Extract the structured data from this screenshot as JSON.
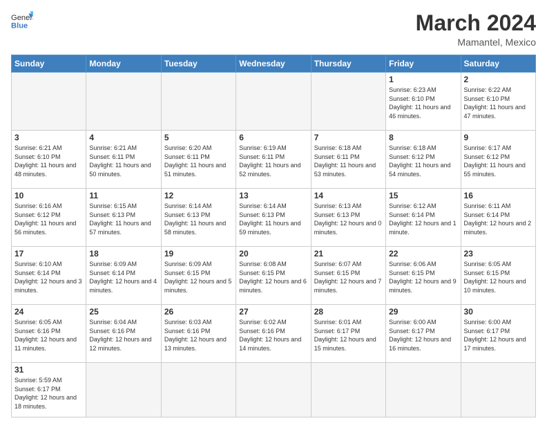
{
  "header": {
    "logo_general": "General",
    "logo_blue": "Blue",
    "month_year": "March 2024",
    "location": "Mamantel, Mexico"
  },
  "weekdays": [
    "Sunday",
    "Monday",
    "Tuesday",
    "Wednesday",
    "Thursday",
    "Friday",
    "Saturday"
  ],
  "weeks": [
    [
      {
        "day": "",
        "empty": true
      },
      {
        "day": "",
        "empty": true
      },
      {
        "day": "",
        "empty": true
      },
      {
        "day": "",
        "empty": true
      },
      {
        "day": "",
        "empty": true
      },
      {
        "day": "1",
        "sunrise": "6:23 AM",
        "sunset": "6:10 PM",
        "daylight": "11 hours and 46 minutes."
      },
      {
        "day": "2",
        "sunrise": "6:22 AM",
        "sunset": "6:10 PM",
        "daylight": "11 hours and 47 minutes."
      }
    ],
    [
      {
        "day": "3",
        "sunrise": "6:21 AM",
        "sunset": "6:10 PM",
        "daylight": "11 hours and 48 minutes."
      },
      {
        "day": "4",
        "sunrise": "6:21 AM",
        "sunset": "6:11 PM",
        "daylight": "11 hours and 50 minutes."
      },
      {
        "day": "5",
        "sunrise": "6:20 AM",
        "sunset": "6:11 PM",
        "daylight": "11 hours and 51 minutes."
      },
      {
        "day": "6",
        "sunrise": "6:19 AM",
        "sunset": "6:11 PM",
        "daylight": "11 hours and 52 minutes."
      },
      {
        "day": "7",
        "sunrise": "6:18 AM",
        "sunset": "6:11 PM",
        "daylight": "11 hours and 53 minutes."
      },
      {
        "day": "8",
        "sunrise": "6:18 AM",
        "sunset": "6:12 PM",
        "daylight": "11 hours and 54 minutes."
      },
      {
        "day": "9",
        "sunrise": "6:17 AM",
        "sunset": "6:12 PM",
        "daylight": "11 hours and 55 minutes."
      }
    ],
    [
      {
        "day": "10",
        "sunrise": "6:16 AM",
        "sunset": "6:12 PM",
        "daylight": "11 hours and 56 minutes."
      },
      {
        "day": "11",
        "sunrise": "6:15 AM",
        "sunset": "6:13 PM",
        "daylight": "11 hours and 57 minutes."
      },
      {
        "day": "12",
        "sunrise": "6:14 AM",
        "sunset": "6:13 PM",
        "daylight": "11 hours and 58 minutes."
      },
      {
        "day": "13",
        "sunrise": "6:14 AM",
        "sunset": "6:13 PM",
        "daylight": "11 hours and 59 minutes."
      },
      {
        "day": "14",
        "sunrise": "6:13 AM",
        "sunset": "6:13 PM",
        "daylight": "12 hours and 0 minutes."
      },
      {
        "day": "15",
        "sunrise": "6:12 AM",
        "sunset": "6:14 PM",
        "daylight": "12 hours and 1 minute."
      },
      {
        "day": "16",
        "sunrise": "6:11 AM",
        "sunset": "6:14 PM",
        "daylight": "12 hours and 2 minutes."
      }
    ],
    [
      {
        "day": "17",
        "sunrise": "6:10 AM",
        "sunset": "6:14 PM",
        "daylight": "12 hours and 3 minutes."
      },
      {
        "day": "18",
        "sunrise": "6:09 AM",
        "sunset": "6:14 PM",
        "daylight": "12 hours and 4 minutes."
      },
      {
        "day": "19",
        "sunrise": "6:09 AM",
        "sunset": "6:15 PM",
        "daylight": "12 hours and 5 minutes."
      },
      {
        "day": "20",
        "sunrise": "6:08 AM",
        "sunset": "6:15 PM",
        "daylight": "12 hours and 6 minutes."
      },
      {
        "day": "21",
        "sunrise": "6:07 AM",
        "sunset": "6:15 PM",
        "daylight": "12 hours and 7 minutes."
      },
      {
        "day": "22",
        "sunrise": "6:06 AM",
        "sunset": "6:15 PM",
        "daylight": "12 hours and 9 minutes."
      },
      {
        "day": "23",
        "sunrise": "6:05 AM",
        "sunset": "6:15 PM",
        "daylight": "12 hours and 10 minutes."
      }
    ],
    [
      {
        "day": "24",
        "sunrise": "6:05 AM",
        "sunset": "6:16 PM",
        "daylight": "12 hours and 11 minutes."
      },
      {
        "day": "25",
        "sunrise": "6:04 AM",
        "sunset": "6:16 PM",
        "daylight": "12 hours and 12 minutes."
      },
      {
        "day": "26",
        "sunrise": "6:03 AM",
        "sunset": "6:16 PM",
        "daylight": "12 hours and 13 minutes."
      },
      {
        "day": "27",
        "sunrise": "6:02 AM",
        "sunset": "6:16 PM",
        "daylight": "12 hours and 14 minutes."
      },
      {
        "day": "28",
        "sunrise": "6:01 AM",
        "sunset": "6:17 PM",
        "daylight": "12 hours and 15 minutes."
      },
      {
        "day": "29",
        "sunrise": "6:00 AM",
        "sunset": "6:17 PM",
        "daylight": "12 hours and 16 minutes."
      },
      {
        "day": "30",
        "sunrise": "6:00 AM",
        "sunset": "6:17 PM",
        "daylight": "12 hours and 17 minutes."
      }
    ],
    [
      {
        "day": "31",
        "sunrise": "5:59 AM",
        "sunset": "6:17 PM",
        "daylight": "12 hours and 18 minutes.",
        "last": true
      },
      {
        "day": "",
        "empty": true,
        "last": true
      },
      {
        "day": "",
        "empty": true,
        "last": true
      },
      {
        "day": "",
        "empty": true,
        "last": true
      },
      {
        "day": "",
        "empty": true,
        "last": true
      },
      {
        "day": "",
        "empty": true,
        "last": true
      },
      {
        "day": "",
        "empty": true,
        "last": true
      }
    ]
  ]
}
